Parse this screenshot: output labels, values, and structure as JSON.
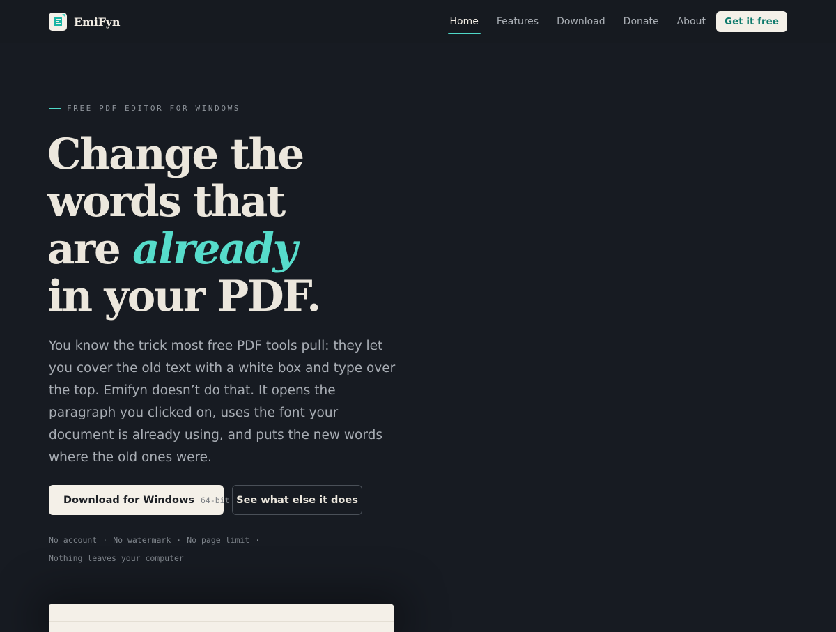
{
  "nav": {
    "brand": "EmiFyn",
    "links": [
      "Home",
      "Features",
      "Download",
      "Donate",
      "About"
    ],
    "active": "Home",
    "cta": "Get it free"
  },
  "hero": {
    "eyebrow": "FREE PDF EDITOR FOR WINDOWS",
    "headline": {
      "line1": "Change the",
      "line2": "words that",
      "line3_start": "are ",
      "accent": "already",
      "line4": "in your PDF."
    },
    "lead": "You know the trick most free PDF tools pull: they let you cover the old text with a white box and type over the top. Emifyn doesn’t do that. It opens the paragraph you clicked on, uses the font your document is already using, and puts the new words where the old ones were.",
    "primary_button": {
      "label": "Download for Windows",
      "tag": "64-bit"
    },
    "secondary_button": "See what else it does",
    "perks": [
      "No account",
      "No watermark",
      "No page limit",
      "Nothing leaves your computer"
    ],
    "separator": "·"
  },
  "colors": {
    "background": "#171b22",
    "accent": "#4fd8c8",
    "cream": "#f4f0e8",
    "cta_text": "#0e7a6c"
  },
  "icons": {
    "logo": "emifyn-logo-icon"
  }
}
